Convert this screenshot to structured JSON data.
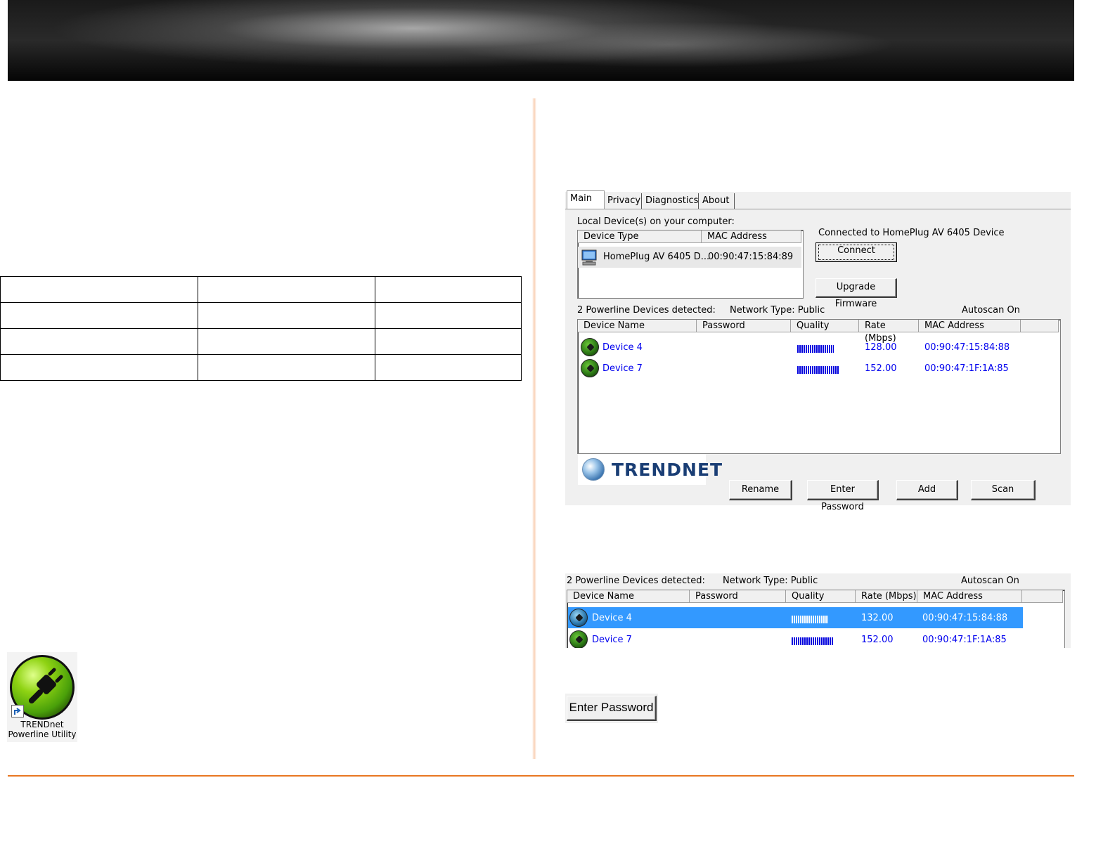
{
  "utility": {
    "tabs": [
      "Main",
      "Privacy",
      "Diagnostics",
      "About"
    ],
    "local_devices_label": "Local Device(s) on your computer:",
    "local_columns": [
      "Device Type",
      "MAC Address"
    ],
    "local_device": {
      "type": "HomePlug AV 6405 D...",
      "mac": "00:90:47:15:84:89"
    },
    "connected_text": "Connected to HomePlug AV 6405 Device",
    "connect_button": "Connect",
    "upgrade_button": "Upgrade Firmware",
    "detected_text": "2 Powerline Devices detected:",
    "network_type": "Network Type: Public",
    "autoscan": "Autoscan On",
    "columns": [
      "Device Name",
      "Password",
      "Quality",
      "Rate (Mbps)",
      "MAC Address"
    ],
    "devices": [
      {
        "name": "Device 4",
        "quality": 0.72,
        "rate": "128.00",
        "mac": "00:90:47:15:84:88"
      },
      {
        "name": "Device 7",
        "quality": 0.88,
        "rate": "152.00",
        "mac": "00:90:47:1F:1A:85"
      }
    ],
    "brand": "TRENDNET",
    "buttons": [
      "Rename",
      "Enter Password",
      "Add",
      "Scan"
    ]
  },
  "zoom_list": {
    "detected_text": "2 Powerline Devices detected:",
    "network_type": "Network Type: Public",
    "autoscan": "Autoscan On",
    "columns": [
      "Device Name",
      "Password",
      "Quality",
      "Rate (Mbps)",
      "MAC Address"
    ],
    "devices": [
      {
        "name": "Device 4",
        "quality": 0.8,
        "rate": "132.00",
        "mac": "00:90:47:15:84:88",
        "selected": true
      },
      {
        "name": "Device 7",
        "quality": 0.9,
        "rate": "152.00",
        "mac": "00:90:47:1F:1A:85",
        "selected": false
      }
    ]
  },
  "enter_password_button": "Enter Password",
  "desktop_icon": {
    "line1": "TRENDnet",
    "line2": "Powerline Utility"
  },
  "colors": {
    "accent_orange": "#e87722",
    "selection_blue": "#3399ff",
    "link_blue": "#0000ee"
  }
}
